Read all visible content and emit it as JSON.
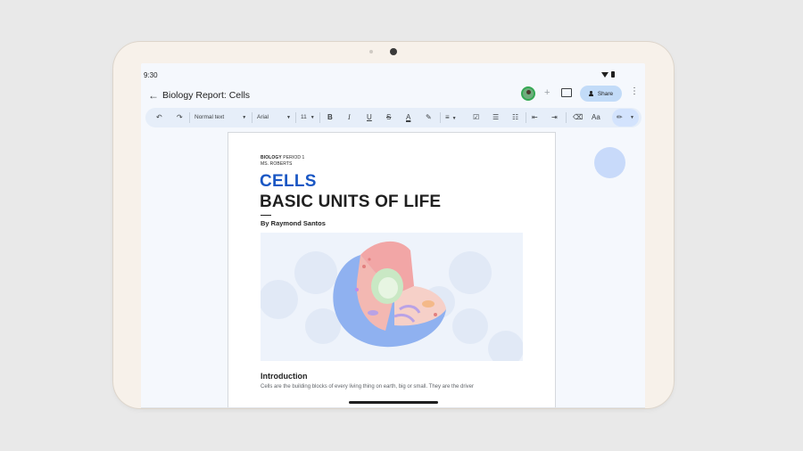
{
  "status_bar": {
    "time": "9:30"
  },
  "app_bar": {
    "document_title": "Biology Report: Cells",
    "share_label": "Share"
  },
  "toolbar": {
    "style_select": "Normal text",
    "font_select": "Arial",
    "size_select": "11",
    "icons": [
      "undo-icon",
      "redo-icon",
      "bold-icon",
      "italic-icon",
      "underline-icon",
      "strikethrough-icon",
      "text-color-icon",
      "highlight-icon",
      "align-icon",
      "checklist-icon",
      "bullet-list-icon",
      "numbered-list-icon",
      "indent-decrease-icon",
      "indent-increase-icon",
      "clear-format-icon",
      "text-style-icon",
      "pen-icon"
    ]
  },
  "document": {
    "class_bold": "BIOLOGY",
    "class_rest": " PERIOD 1",
    "teacher": "MS. ROBERTS",
    "heading_blue": "CELLS",
    "heading_black": "BASIC UNITS OF LIFE",
    "byline": "By Raymond Santos",
    "intro_heading": "Introduction",
    "intro_text": "Cells are the building blocks of every living thing on earth, big or small. They are the driver"
  },
  "colors": {
    "accent_blue": "#1a57c4",
    "share_bg": "#c2dbf8",
    "toolbar_bg": "#e6eef9",
    "screen_bg": "#f5f8fd",
    "device_frame": "#f7f1ea"
  }
}
